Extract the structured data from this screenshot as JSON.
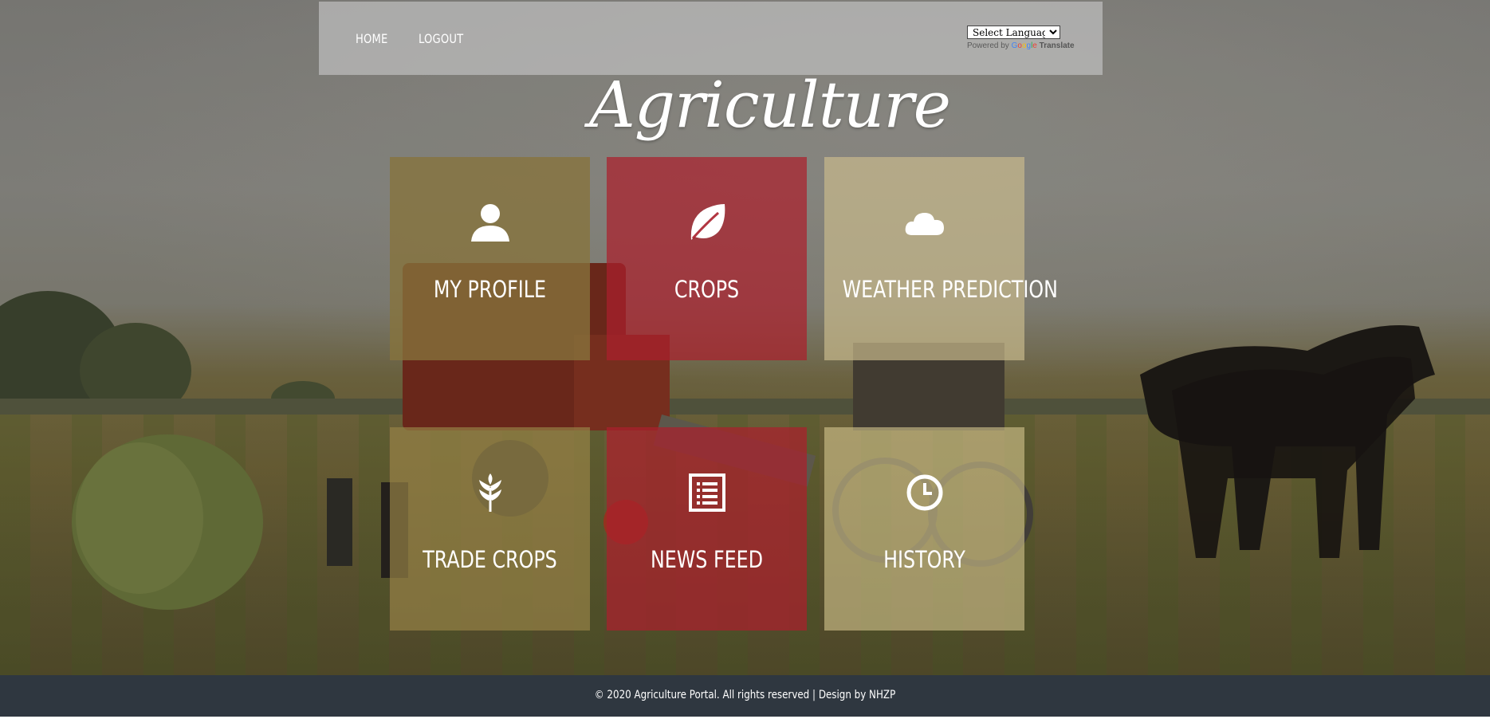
{
  "nav": {
    "home_label": "HOME",
    "logout_label": "LOGOUT"
  },
  "translate": {
    "select_label": "Select Language",
    "powered_by": "Powered by",
    "google_g": "G",
    "google_o1": "o",
    "google_o2": "o",
    "google_g2": "g",
    "google_l": "l",
    "google_e": "e",
    "translate_word": "Translate"
  },
  "site": {
    "title": "Agriculture"
  },
  "tiles": [
    {
      "label": "MY PROFILE",
      "icon": "user-icon"
    },
    {
      "label": "CROPS",
      "icon": "leaf-icon"
    },
    {
      "label": "WEATHER PREDICTION",
      "icon": "cloud-icon"
    },
    {
      "label": "TRADE CROPS",
      "icon": "wheat-icon"
    },
    {
      "label": "NEWS FEED",
      "icon": "news-list-icon"
    },
    {
      "label": "HISTORY",
      "icon": "clock-icon"
    }
  ],
  "footer": {
    "text": "© 2020 Agriculture Portal. All rights reserved | Design by NHZP"
  },
  "colors": {
    "tile_olive": "#87733c",
    "tile_red": "#aa202c",
    "tile_sand": "#c8b98c",
    "footer_bg": "#2f3740",
    "navbar_bg": "#bebebe"
  }
}
